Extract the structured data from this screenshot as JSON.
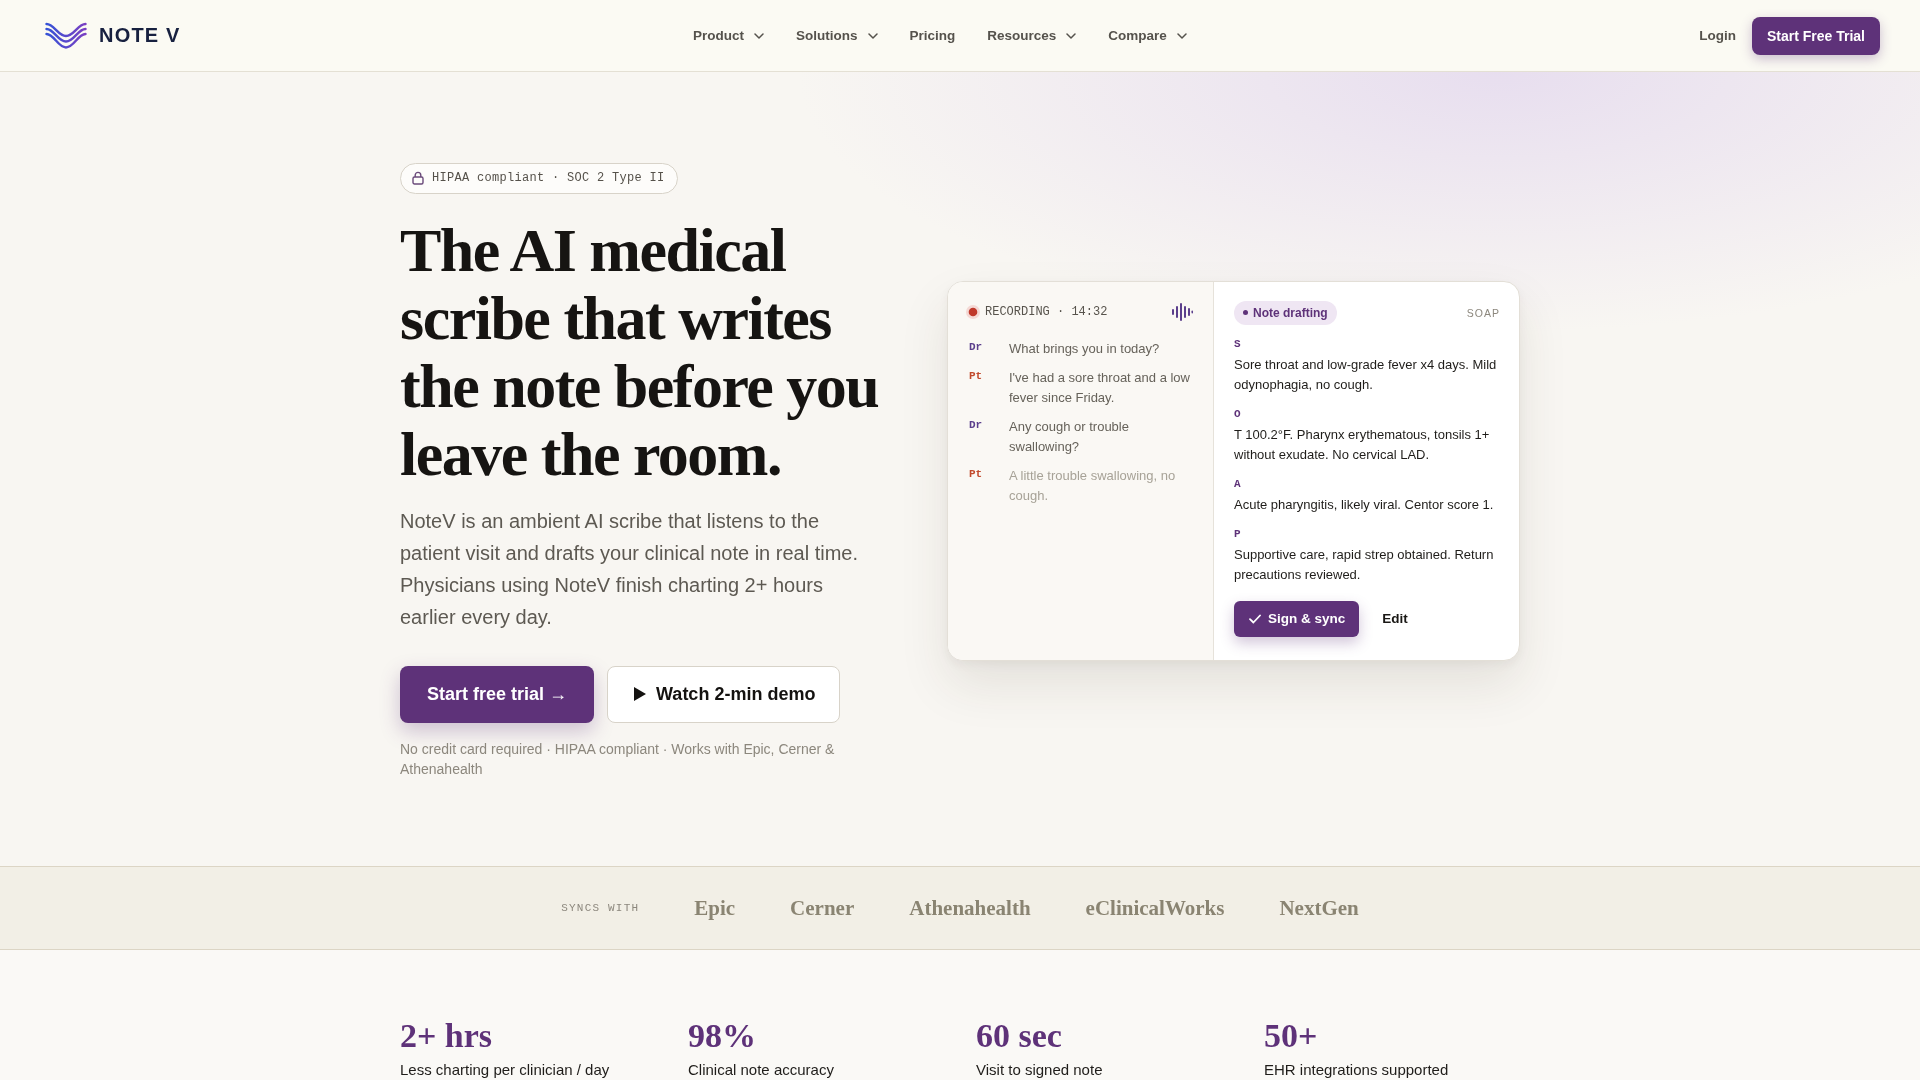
{
  "nav": {
    "logo": "NOTE V",
    "items": [
      {
        "label": "Product",
        "dropdown": true
      },
      {
        "label": "Solutions",
        "dropdown": true
      },
      {
        "label": "Pricing",
        "dropdown": false
      },
      {
        "label": "Resources",
        "dropdown": true
      },
      {
        "label": "Compare",
        "dropdown": true
      }
    ],
    "login": "Login",
    "cta": "Start Free Trial"
  },
  "hero": {
    "badge": "HIPAA compliant · SOC 2 Type II",
    "heading": "The AI medical scribe that writes the note before you leave the room.",
    "body": "NoteV is an ambient AI scribe that listens to the patient visit and drafts your clinical note in real time. Physicians using NoteV finish charting 2+ hours earlier every day.",
    "primary_button": "Start free trial →",
    "secondary_button": "Watch 2-min demo",
    "footnote": "No credit card required · HIPAA compliant · Works with Epic, Cerner & Athenahealth"
  },
  "demo_card": {
    "recording": {
      "label": "RECORDING · 14:32",
      "active": true
    },
    "transcript": [
      {
        "speaker": "Dr",
        "kind": "doctor",
        "text": "What brings you in today?",
        "interim": false
      },
      {
        "speaker": "Pt",
        "kind": "patient",
        "text": "I've had a sore throat and a low fever since Friday.",
        "interim": false
      },
      {
        "speaker": "Dr",
        "kind": "doctor",
        "text": "Any cough or trouble swallowing?",
        "interim": false
      },
      {
        "speaker": "Pt",
        "kind": "patient",
        "text": "A little trouble swallowing, no cough.",
        "interim": true
      }
    ],
    "note": {
      "status": "Note drafting",
      "format": "SOAP",
      "sections": [
        {
          "label": "S",
          "text": "Sore throat and low-grade fever x4 days. Mild odynophagia, no cough."
        },
        {
          "label": "O",
          "text": "T 100.2°F. Pharynx erythematous, tonsils 1+ without exudate. No cervical LAD."
        },
        {
          "label": "A",
          "text": "Acute pharyngitis, likely viral. Centor score 1."
        },
        {
          "label": "P",
          "text": "Supportive care, rapid strep obtained. Return precautions reviewed."
        }
      ],
      "primary_action": "Sign & sync",
      "secondary_action": "Edit"
    }
  },
  "integrations": {
    "label": "SYNCS WITH",
    "items": [
      "Epic",
      "Cerner",
      "Athenahealth",
      "eClinicalWorks",
      "NextGen"
    ]
  },
  "stats": [
    {
      "value": "2+ hrs",
      "label": "Less charting per clinician / day"
    },
    {
      "value": "98%",
      "label": "Clinical note accuracy"
    },
    {
      "value": "60 sec",
      "label": "Visit to signed note"
    },
    {
      "value": "50+",
      "label": "EHR integrations supported"
    }
  ]
}
